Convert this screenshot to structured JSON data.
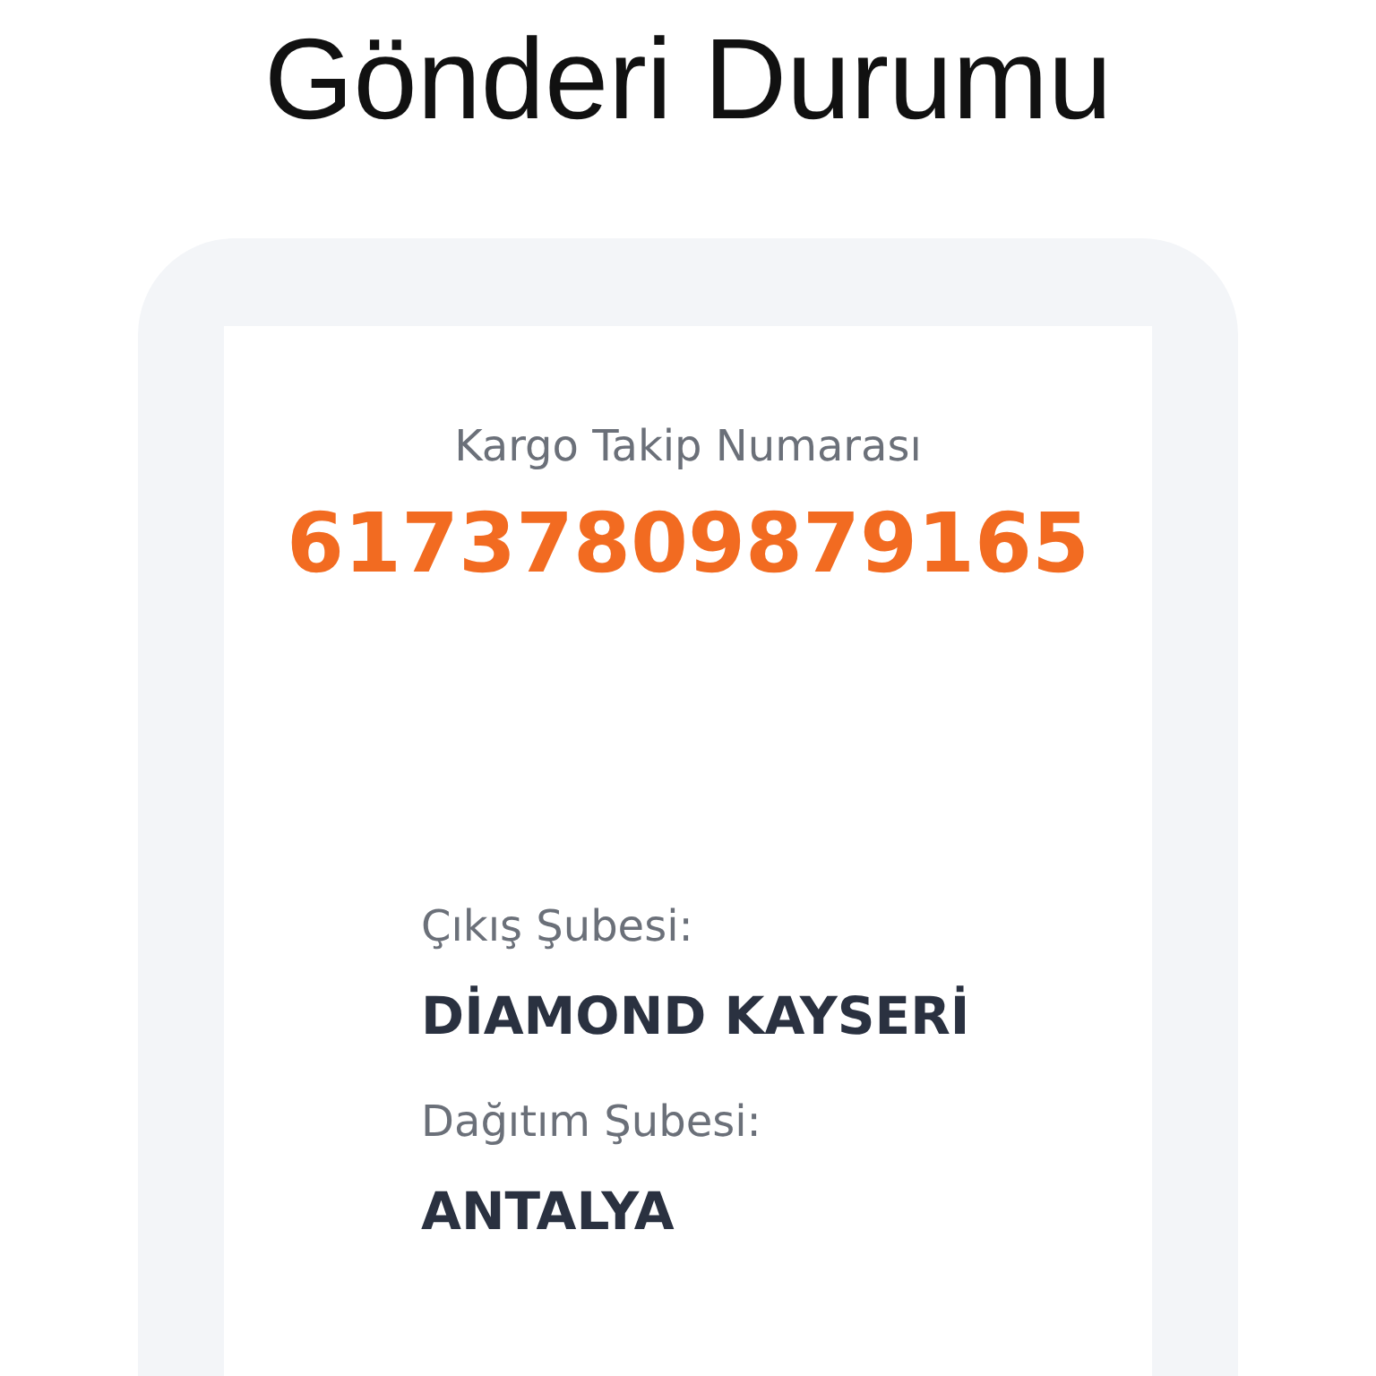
{
  "title": "Gönderi Durumu",
  "tracking": {
    "label": "Kargo Takip Numarası",
    "number": "61737809879165"
  },
  "fields": [
    {
      "label": "Çıkış Şubesi:",
      "value": "DİAMOND KAYSERİ"
    },
    {
      "label": "Dağıtım Şubesi:",
      "value": "ANTALYA"
    }
  ]
}
